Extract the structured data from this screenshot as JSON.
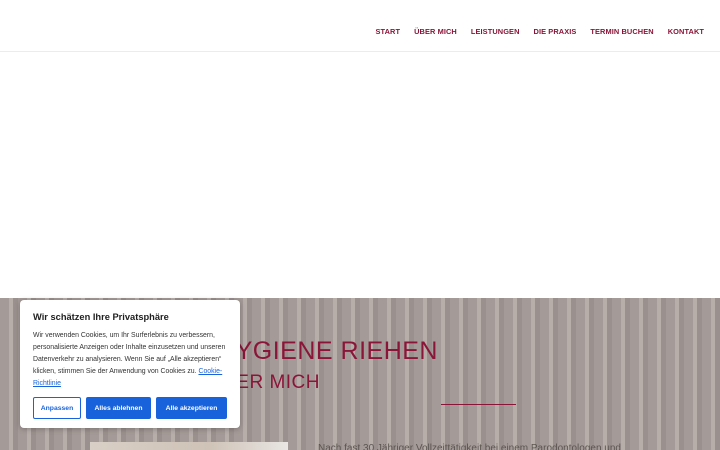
{
  "nav": {
    "items": [
      {
        "label": "START"
      },
      {
        "label": "ÜBER MICH"
      },
      {
        "label": "LEISTUNGEN"
      },
      {
        "label": "DIE PRAXIS"
      },
      {
        "label": "TERMIN BUCHEN"
      },
      {
        "label": "KONTAKT"
      }
    ]
  },
  "section": {
    "title": "HYGIENE RIEHEN",
    "subtitle": "ER MICH",
    "intro_text": "Nach fast 30 Jähriger Vollzeittätigkeit bei einem Parodontologen und"
  },
  "cookie": {
    "title": "Wir schätzen Ihre Privatsphäre",
    "text": "Wir verwenden Cookies, um Ihr Surferlebnis zu verbessern, personalisierte Anzeigen oder Inhalte einzusetzen und unseren Datenverkehr zu analysieren. Wenn Sie auf „Alle akzeptieren“ klicken, stimmen Sie der Anwendung von Cookies zu.",
    "link_label": "Cookie-Richtlinie",
    "customize_label": "Anpassen",
    "reject_label": "Alles ablehnen",
    "accept_label": "Alle akzeptieren"
  },
  "colors": {
    "brand": "#8a1538",
    "button_blue": "#1863dc"
  }
}
